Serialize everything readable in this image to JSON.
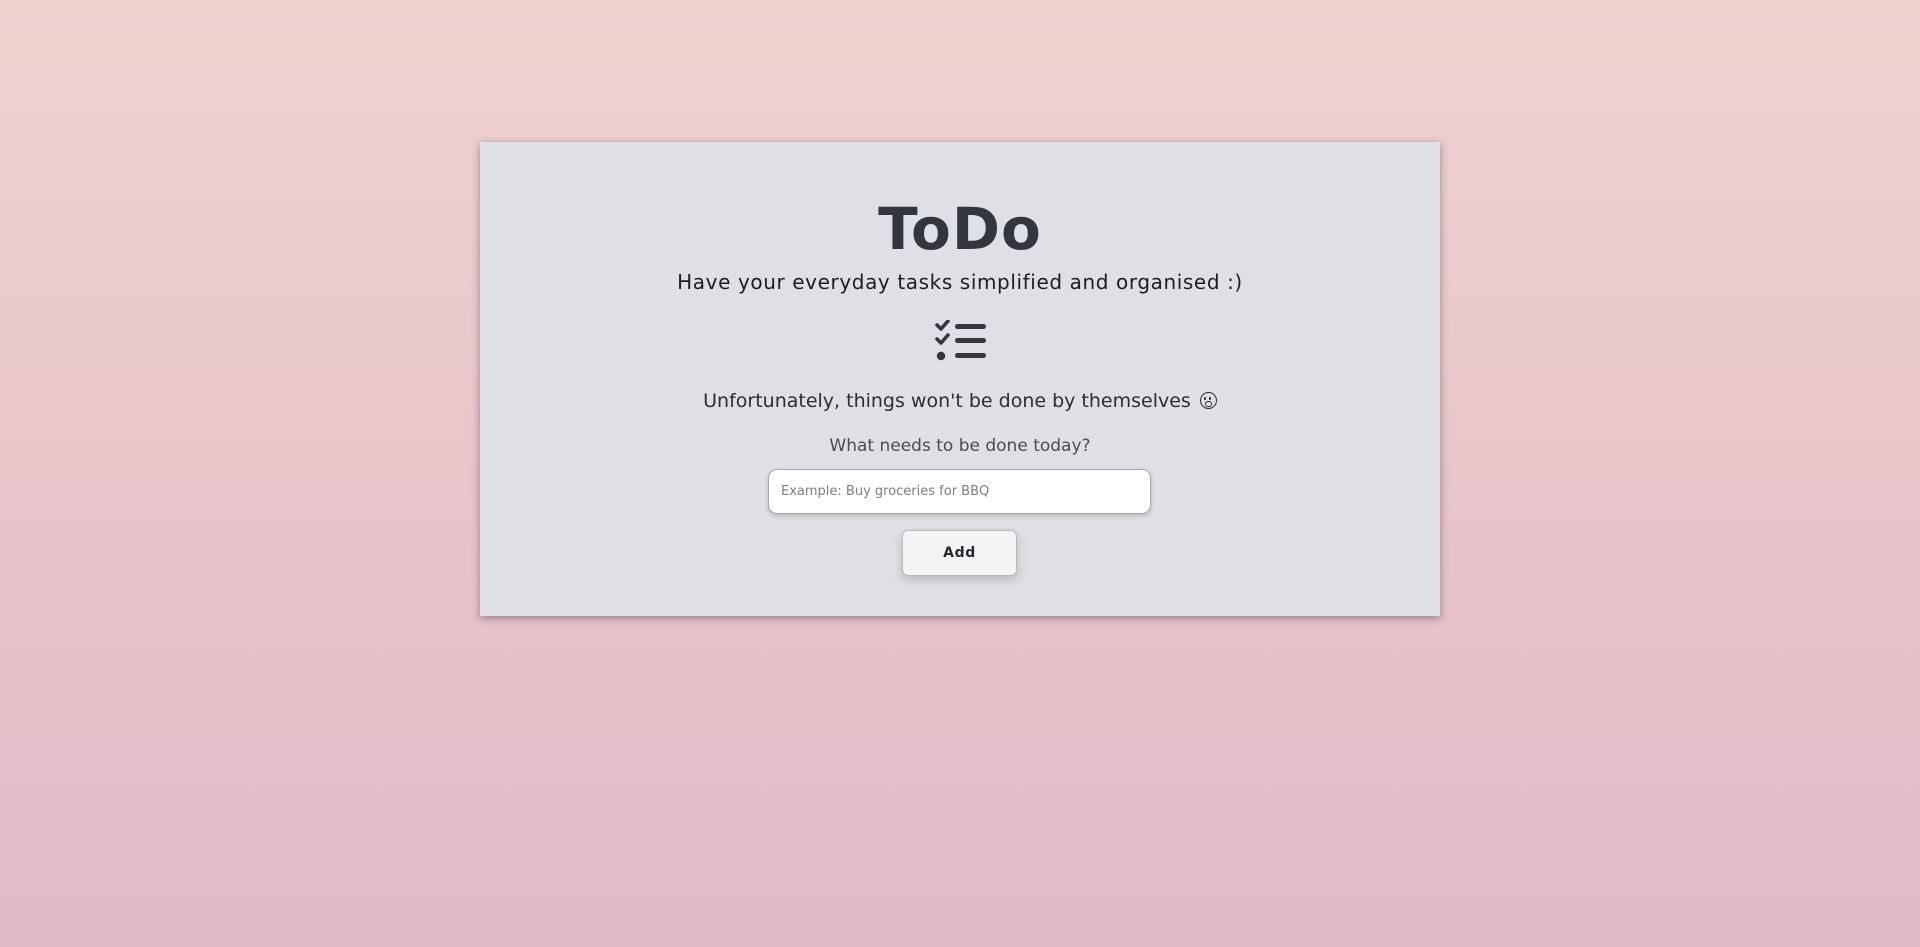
{
  "app": {
    "title": "ToDo",
    "subtitle": "Have your everyday tasks simplified and organised :)",
    "icon": "task-list-icon"
  },
  "message": {
    "text": "Unfortunately, things won't be done by themselves",
    "emoji_icon": "face-screaming-icon"
  },
  "form": {
    "prompt": "What needs to be done today?",
    "input_value": "",
    "input_placeholder": "Example: Buy groceries for BBQ",
    "add_label": "Add"
  },
  "colors": {
    "background_top": "#efd3cf",
    "background_bottom": "#e1bac8",
    "card": "#dee0e5",
    "title": "#33363d"
  }
}
